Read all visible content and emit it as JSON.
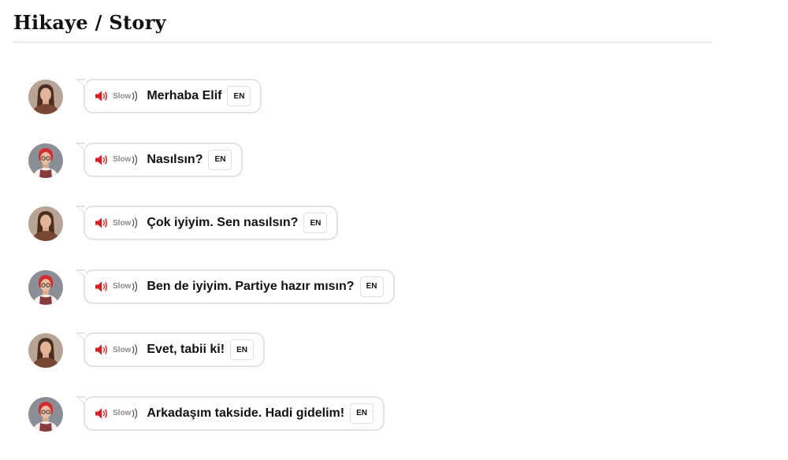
{
  "page": {
    "title": "Hikaye / Story"
  },
  "controls": {
    "slow_label": "Slow",
    "translate_label": "EN"
  },
  "colors": {
    "speaker_red": "#e31b1b",
    "bubble_border": "#e2e2e2",
    "speaker_a_bg": "#b7a494",
    "speaker_b_bg": "#8a8e96",
    "elif_hair": "#d42b2b"
  },
  "messages": [
    {
      "speaker": "speaker-a",
      "text": "Merhaba Elif"
    },
    {
      "speaker": "speaker-b",
      "text": "Nasılsın?"
    },
    {
      "speaker": "speaker-a",
      "text": "Çok iyiyim. Sen nasılsın?"
    },
    {
      "speaker": "speaker-b",
      "text": "Ben de iyiyim. Partiye hazır mısın?"
    },
    {
      "speaker": "speaker-a",
      "text": "Evet, tabii ki!"
    },
    {
      "speaker": "speaker-b",
      "text": "Arkadaşım takside. Hadi gidelim!"
    }
  ]
}
